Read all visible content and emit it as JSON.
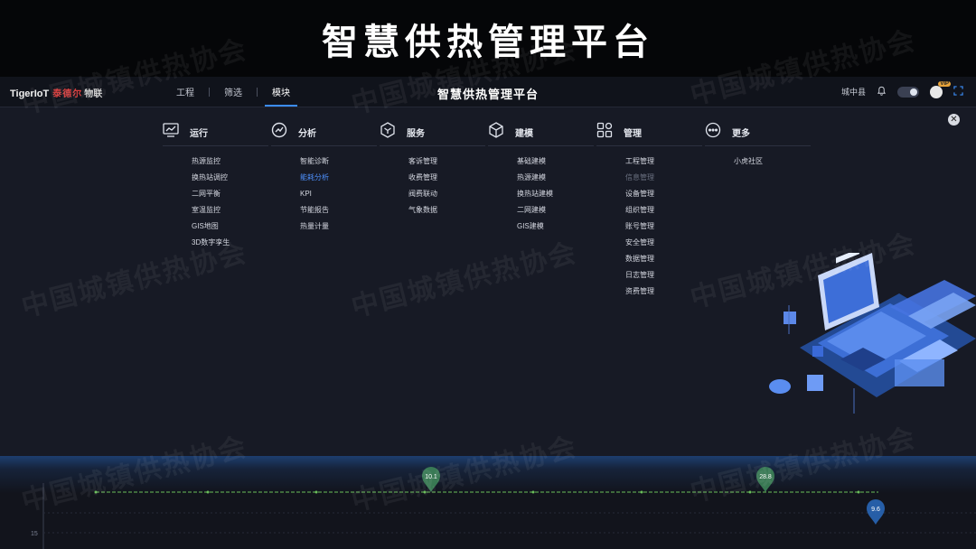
{
  "banner": {
    "title": "智慧供热管理平台"
  },
  "brand": {
    "logo_en": "TigerIoT",
    "logo_cn": "泰德尔",
    "logo_cn2": "物联"
  },
  "nav": {
    "items": [
      {
        "label": "工程",
        "active": false
      },
      {
        "label": "筛选",
        "active": false
      },
      {
        "label": "模块",
        "active": true
      }
    ]
  },
  "header": {
    "title": "智慧供热管理平台",
    "location": "城中县",
    "vip_badge": "VIP"
  },
  "menu": [
    {
      "title": "运行",
      "icon": "line-chart-icon",
      "items": [
        {
          "label": "热源监控",
          "state": "normal"
        },
        {
          "label": "换热站调控",
          "state": "normal"
        },
        {
          "label": "二网平衡",
          "state": "normal"
        },
        {
          "label": "室温监控",
          "state": "normal"
        },
        {
          "label": "GIS地图",
          "state": "normal"
        },
        {
          "label": "3D数字孪生",
          "state": "normal"
        }
      ]
    },
    {
      "title": "分析",
      "icon": "trend-analysis-icon",
      "items": [
        {
          "label": "智能诊断",
          "state": "normal"
        },
        {
          "label": "能耗分析",
          "state": "active"
        },
        {
          "label": "KPI",
          "state": "normal"
        },
        {
          "label": "节能报告",
          "state": "normal"
        },
        {
          "label": "热量计量",
          "state": "normal"
        }
      ]
    },
    {
      "title": "服务",
      "icon": "hexagon-service-icon",
      "items": [
        {
          "label": "客诉管理",
          "state": "normal"
        },
        {
          "label": "收费管理",
          "state": "normal"
        },
        {
          "label": "阀费联动",
          "state": "normal"
        },
        {
          "label": "气象数据",
          "state": "normal"
        }
      ]
    },
    {
      "title": "建模",
      "icon": "cube-model-icon",
      "items": [
        {
          "label": "基础建模",
          "state": "normal"
        },
        {
          "label": "热源建模",
          "state": "normal"
        },
        {
          "label": "换热站建模",
          "state": "normal"
        },
        {
          "label": "二网建模",
          "state": "normal"
        },
        {
          "label": "GIS建模",
          "state": "normal"
        }
      ]
    },
    {
      "title": "管理",
      "icon": "grid-apps-icon",
      "items": [
        {
          "label": "工程管理",
          "state": "normal"
        },
        {
          "label": "信息管理",
          "state": "disabled"
        },
        {
          "label": "设备管理",
          "state": "normal"
        },
        {
          "label": "组织管理",
          "state": "normal"
        },
        {
          "label": "账号管理",
          "state": "normal"
        },
        {
          "label": "安全管理",
          "state": "normal"
        },
        {
          "label": "数据管理",
          "state": "normal"
        },
        {
          "label": "日志管理",
          "state": "normal"
        },
        {
          "label": "资费管理",
          "state": "normal"
        }
      ]
    },
    {
      "title": "更多",
      "icon": "more-dots-icon",
      "items": [
        {
          "label": "小虎社区",
          "state": "normal"
        }
      ]
    }
  ],
  "chart_data": {
    "type": "line",
    "series": [
      {
        "values": [
          5.0,
          5.0
        ]
      }
    ],
    "markers": [
      {
        "label": "10.1",
        "color": "#3f8a5a"
      },
      {
        "label": "28.8",
        "color": "#3f8a5a"
      },
      {
        "label": "9.6",
        "color": "#2a6bc0"
      }
    ],
    "yticks": [
      "15"
    ]
  },
  "watermark": {
    "text": "中国城镇供热协会"
  },
  "colors": {
    "accent": "#3b8cf5",
    "active_item": "#4d8ef8",
    "background": "#171a25",
    "series": "#6abf5a"
  }
}
